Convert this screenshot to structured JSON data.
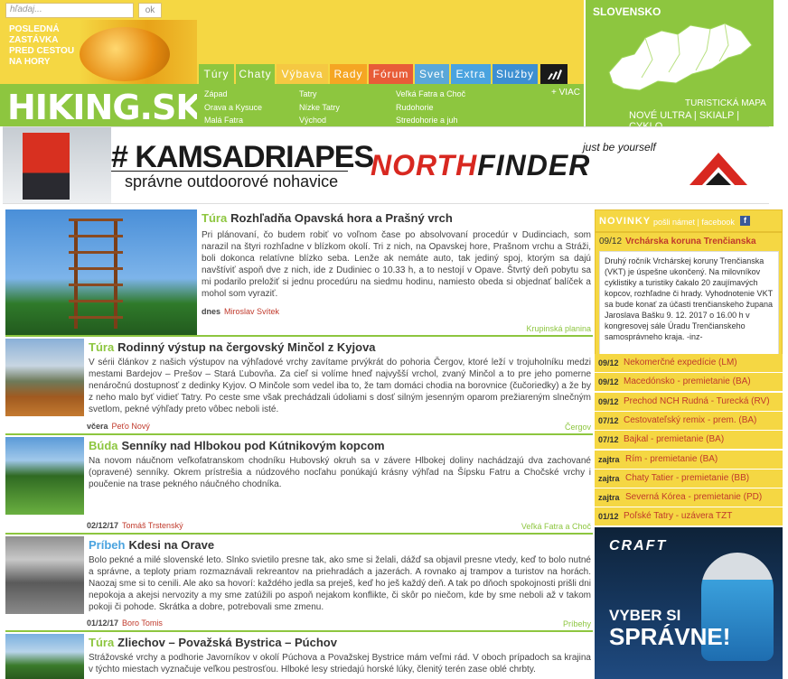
{
  "header": {
    "search_placeholder": "hľadaj...",
    "search_button": "ok",
    "promo_text": [
      "POSLEDNÁ",
      "ZASTÁVKA",
      "PRED CESTOU",
      "NA HORY"
    ],
    "logo_main": "HIKING",
    "logo_suffix": ".SK",
    "nav": [
      {
        "label": "Túry",
        "color": "#8dc63f"
      },
      {
        "label": "Chaty",
        "color": "#8dc63f"
      },
      {
        "label": "Výbava",
        "color": "#f5c842"
      },
      {
        "label": "Rady",
        "color": "#f5a623"
      },
      {
        "label": "Fórum",
        "color": "#e85c38"
      },
      {
        "label": "Svet",
        "color": "#5aa7d8"
      },
      {
        "label": "Extra",
        "color": "#4aa3df"
      },
      {
        "label": "Služby",
        "color": "#3d8fd1"
      }
    ],
    "regions": [
      [
        "Západ",
        "Orava a Kysuce",
        "Malá Fatra"
      ],
      [
        "Tatry",
        "Nízke Tatry",
        "Východ"
      ],
      [
        "Veľká Fatra a Choč",
        "Rudohorie",
        "Stredohorie a juh"
      ]
    ],
    "viac": "+ VIAC",
    "map_title": "SLOVENSKO",
    "map_subtitle": "TURISTICKÁ MAPA",
    "map_links": "NOVÉ ULTRA | SKIALP | CYKLO"
  },
  "banner": {
    "hashtag": "# KAMSADRIAPES",
    "tagline": "správne outdoorové nohavice",
    "slogan": "just be yourself",
    "brand_a": "NORTH",
    "brand_b": "FINDER"
  },
  "articles": [
    {
      "category": "Túra",
      "category_color": "#8dc63f",
      "title": "Rozhľadňa Opavská hora a Prašný vrch",
      "body": "Pri plánovaní, čo budem robiť vo voľnom čase po absolvovaní procedúr v Dudinciach, som narazil na štyri rozhľadne v blízkom okolí. Tri z nich, na Opavskej hore, Prašnom vrchu a Stráži, boli dokonca relatívne blízko seba. Lenže ak nemáte auto, tak jediný spoj, ktorým sa dajú navštíviť aspoň dve z nich, ide z Dudiniec o 10.33 h, a to nestojí v Opave. Štvrtý deň pobytu sa mi podarilo preložiť si jednu procedúru na siedmu hodinu, namiesto obeda si objednať balíček a mohol som vyraziť.",
      "date": "dnes",
      "author": "Miroslav Svítek",
      "region": "Krupinská planina"
    },
    {
      "category": "Túra",
      "category_color": "#8dc63f",
      "title": "Rodinný výstup na čergovský Minčol z Kyjova",
      "body": "V sérii článkov z našich výstupov na výhľadové vrchy zavítame prvýkrát do pohoria Čergov, ktoré leží v trojuholníku medzi mestami Bardejov – Prešov – Stará Ľubovňa. Za cieľ si volíme hneď najvyšší vrchol, zvaný Minčol a to pre jeho pomerne nenáročnú dostupnosť z dedinky Kyjov. O Minčole som vedel iba to, že tam domáci chodia na borovnice (čučoriedky) a že by z neho malo byť vidieť Tatry. Po ceste sme však prechádzali údoliami s dosť silným jesenným oparom prežiareným slnečným svetlom, pekné výhľady preto vôbec neboli isté.",
      "date": "včera",
      "author": "Peťo Nový",
      "region": "Čergov"
    },
    {
      "category": "Búda",
      "category_color": "#8dc63f",
      "title": "Senníky nad Hlbokou pod Kútnikovým kopcom",
      "body": "Na novom náučnom veľkofatranskom chodníku Hubovský okruh sa v závere Hlbokej doliny nachádzajú dva zachované (opravené) senníky. Okrem prístrešia a núdzového nocľahu ponúkajú krásny výhľad na Šípsku Fatru a Chočské vrchy i poučenie na trase pekného náučného chodníka.",
      "date": "02/12/17",
      "author": "Tomáš Trstenský",
      "region": "Veľká Fatra a Choč"
    },
    {
      "category": "Príbeh",
      "category_color": "#4aa3df",
      "title": "Kdesi na Orave",
      "body": "Bolo pekné a milé slovenské leto. Slnko svietilo presne tak, ako sme si želali, dážď sa objavil presne vtedy, keď to bolo nutné a správne, a teploty priam rozmaznávali rekreantov na priehradách a jazerách. A rovnako aj trampov a turistov na horách. Naozaj sme si to cenili. Ale ako sa hovorí: každého jedla sa preješ, keď ho ješ každý deň. A tak po dňoch spokojnosti prišli dni nepokoja a akejsi nervozity a my sme zatúžili po aspoň nejakom konflikte, či skôr po niečom, kde by sme neboli až v takom pokoji či pohode. Skrátka a dobre, potrebovali sme zmenu.",
      "date": "01/12/17",
      "author": "Boro Tomis",
      "region": "Príbehy"
    },
    {
      "category": "Túra",
      "category_color": "#8dc63f",
      "title": "Zliechov – Považská Bystrica – Púchov",
      "body": "Strážovské vrchy a podhorie Javorníkov v okolí Púchova a Považskej Bystrice mám veľmi rád. V oboch prípadoch sa krajina v týchto miestach vyznačuje veľkou pestrosťou. Hlboké lesy striedajú horské lúky, členitý terén zase oblé chrbty.",
      "date": "",
      "author": "",
      "region": ""
    }
  ],
  "sidebar": {
    "news_title": "NOVINKY",
    "news_links": "pošli námet | facebook",
    "featured_date": "09/12",
    "featured_title": "Vrchárska koruna Trenčianska",
    "featured_body": "Druhý ročník Vrchárskej koruny Trenčianska (VKT) je úspešne ukončený. Na milovníkov cyklistiky a turistiky čakalo 20 zaujímavých kopcov, rozhľadne či hrady. Vyhodnotenie VKT sa bude konať za účasti trenčianskeho župana Jaroslava Bašku 9. 12. 2017 o 16.00 h v kongresovej sále Úradu Trenčianskeho samosprávneho kraja. -inz-",
    "items": [
      {
        "date": "09/12",
        "title": "Nekomerčné expedície (LM)"
      },
      {
        "date": "09/12",
        "title": "Macedónsko - premietanie (BA)"
      },
      {
        "date": "09/12",
        "title": "Prechod NCH Rudná - Turecká (RV)"
      },
      {
        "date": "07/12",
        "title": "Cestovateľský remix - prem. (BA)"
      },
      {
        "date": "07/12",
        "title": "Bajkal - premietanie (BA)"
      },
      {
        "date": "zajtra",
        "title": "Rím - premietanie (BA)"
      },
      {
        "date": "zajtra",
        "title": "Chaty Tatier - premietanie (BB)"
      },
      {
        "date": "zajtra",
        "title": "Severná Kórea - premietanie (PD)"
      },
      {
        "date": "01/12",
        "title": "Poľské Tatry - uzávera TZT"
      }
    ],
    "ad_brand": "CRAFT",
    "ad_line1": "VYBER SI",
    "ad_line2": "SPRÁVNE!"
  }
}
